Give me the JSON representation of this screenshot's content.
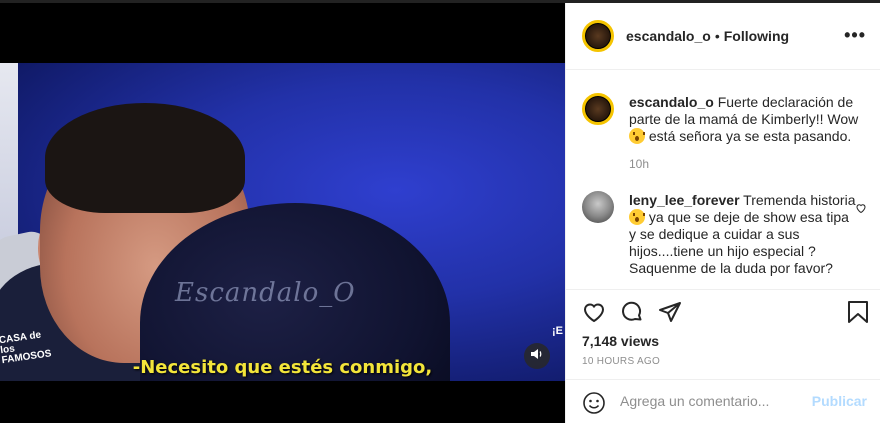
{
  "video": {
    "watermark": "Escandalo_O",
    "subtitle": "-Necesito que estés conmigo,",
    "channel_logo": "CASA de los FAMOSOS",
    "right_mark": "¡E"
  },
  "post": {
    "username": "escandalo_o",
    "separator": "•",
    "follow_status": "Following",
    "more_label": "•••"
  },
  "caption": {
    "username": "escandalo_o",
    "text_1": " Fuerte declaración de parte de la mamá de Kimberly!! Wow ",
    "text_2": " está señora ya se esta pasando.",
    "time": "10h"
  },
  "comment": {
    "username": "leny_lee_forever",
    "text_1": " Tremenda historia ",
    "text_2": " ya que se deje de show esa tipa y se dedique a cuidar a sus hijos....tiene un hijo especial ? Saquenme de la duda por favor?"
  },
  "stats": {
    "views": "7,148 views",
    "ago": "10 HOURS AGO"
  },
  "add_comment": {
    "placeholder": "Agrega un comentario...",
    "publish_label": "Publicar"
  },
  "colors": {
    "emoji": "#ffcc33",
    "subtitle": "#f3e53a",
    "publish_disabled": "#b3dbff"
  },
  "icons": [
    "heart-icon",
    "comment-icon",
    "share-icon",
    "bookmark-icon",
    "smile-icon",
    "speaker-icon",
    "more-icon"
  ]
}
